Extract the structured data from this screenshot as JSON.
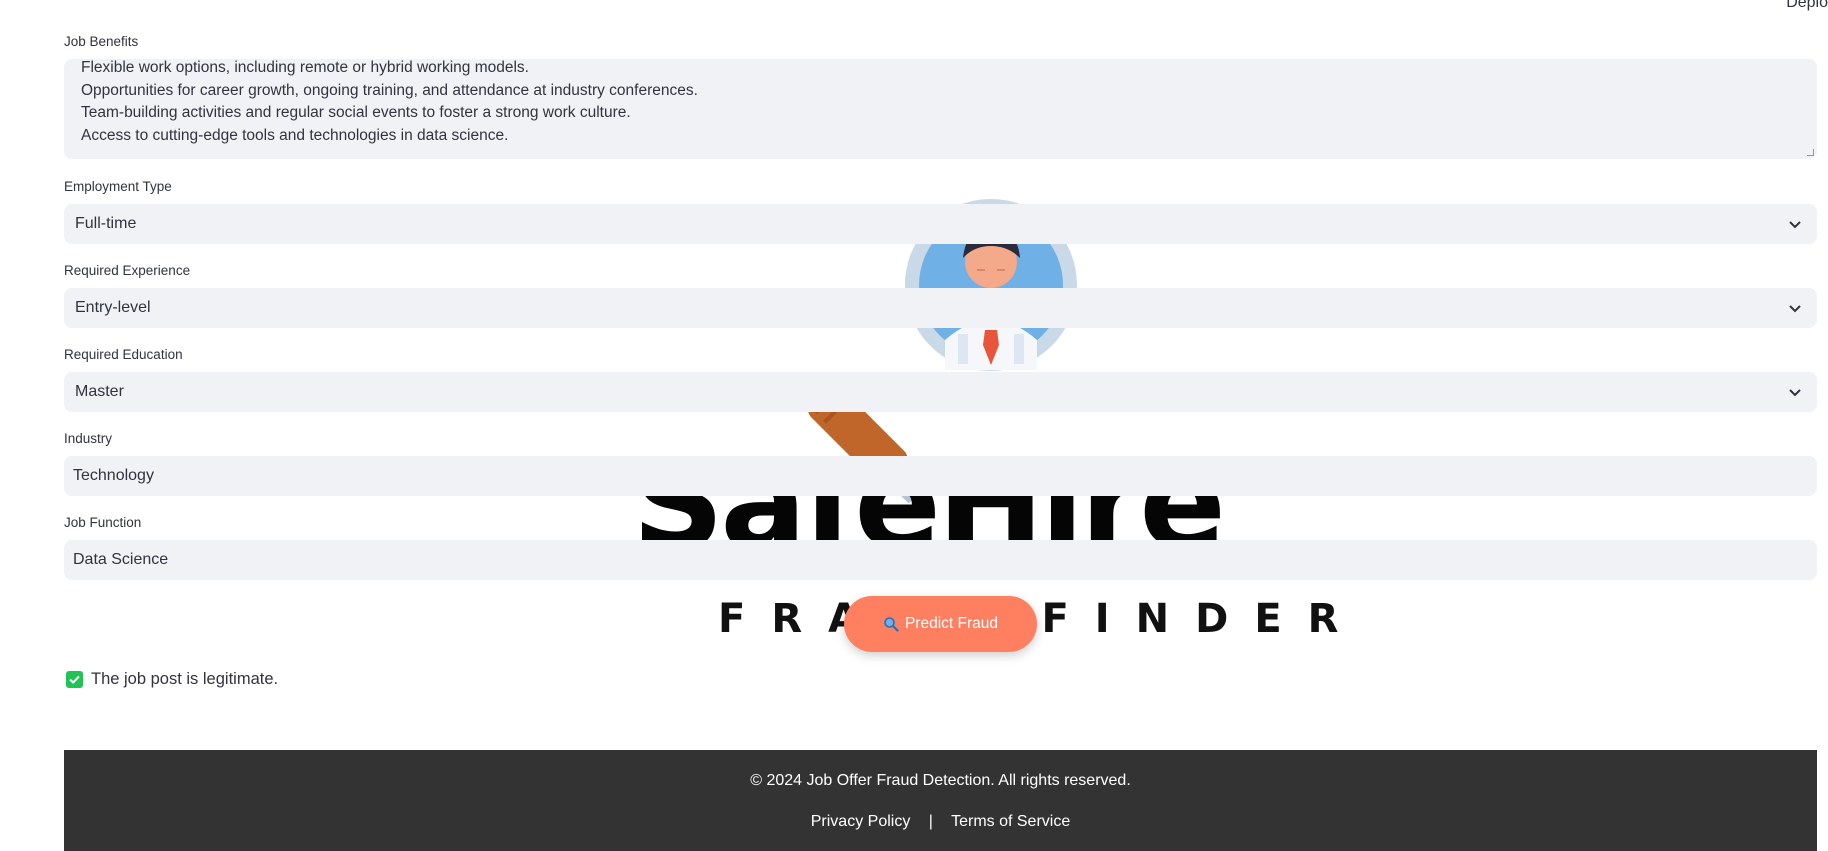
{
  "header": {
    "deploy_label": "Deplo"
  },
  "brand": {
    "name": "SafeHire",
    "tagline": "FRAUD FINDER"
  },
  "form": {
    "benefits": {
      "label": "Job Benefits",
      "lines": [
        "Flexible work options, including remote or hybrid working models.",
        "Opportunities for career growth, ongoing training, and attendance at industry conferences.",
        "Team-building activities and regular social events to foster a strong work culture.",
        "Access to cutting-edge tools and technologies in data science."
      ]
    },
    "employment_type": {
      "label": "Employment Type",
      "value": "Full-time"
    },
    "required_experience": {
      "label": "Required Experience",
      "value": "Entry-level"
    },
    "required_education": {
      "label": "Required Education",
      "value": "Master"
    },
    "industry": {
      "label": "Industry",
      "value": "Technology"
    },
    "job_function": {
      "label": "Job Function",
      "value": "Data Science"
    }
  },
  "predict_button": {
    "label": "Predict Fraud",
    "icon": "magnifier-icon"
  },
  "result": {
    "text": "The job post is legitimate.",
    "status_color": "#21c354"
  },
  "footer": {
    "copyright": "© 2024 Job Offer Fraud Detection. All rights reserved.",
    "privacy": "Privacy Policy",
    "separator": "|",
    "terms": "Terms of Service"
  },
  "colors": {
    "accent": "#ff7f61",
    "field_bg": "#f0f2f6",
    "footer_bg": "#333333"
  }
}
